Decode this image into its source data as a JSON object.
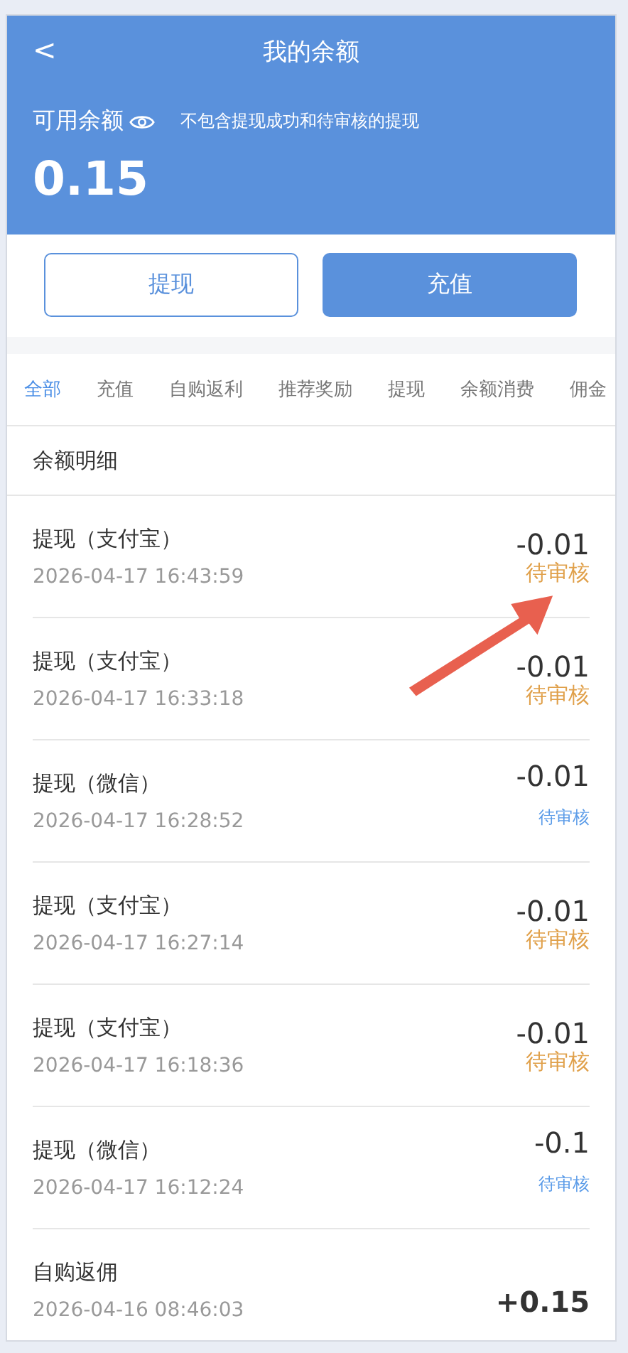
{
  "header": {
    "back": "<",
    "title": "我的余额"
  },
  "balance": {
    "label": "可用余额",
    "hint": "不包含提现成功和待审核的提现",
    "amount": "0.15"
  },
  "buttons": [
    {
      "label": "提现",
      "kind": "outline"
    },
    {
      "label": "充值",
      "kind": "filled"
    }
  ],
  "tabs": [
    {
      "label": "全部",
      "selected": true
    },
    {
      "label": "充值",
      "selected": false
    },
    {
      "label": "自购返利",
      "selected": false
    },
    {
      "label": "推荐奖励",
      "selected": false
    },
    {
      "label": "提现",
      "selected": false
    },
    {
      "label": "余额消费",
      "selected": false
    },
    {
      "label": "佣金",
      "selected": false
    }
  ],
  "section_title": "余额明细",
  "records": [
    {
      "title": "提现（支付宝）",
      "time": "2026-04-17 16:43:59",
      "amount": "-0.01",
      "status": "待审核",
      "kind": "alipay"
    },
    {
      "title": "提现（支付宝）",
      "time": "2026-04-17 16:33:18",
      "amount": "-0.01",
      "status": "待审核",
      "kind": "alipay"
    },
    {
      "title": "提现（微信）",
      "time": "2026-04-17 16:28:52",
      "amount": "-0.01",
      "status": "待审核",
      "kind": "wechat"
    },
    {
      "title": "提现（支付宝）",
      "time": "2026-04-17 16:27:14",
      "amount": "-0.01",
      "status": "待审核",
      "kind": "alipay"
    },
    {
      "title": "提现（支付宝）",
      "time": "2026-04-17 16:18:36",
      "amount": "-0.01",
      "status": "待审核",
      "kind": "alipay"
    },
    {
      "title": "提现（微信）",
      "time": "2026-04-17 16:12:24",
      "amount": "-0.1",
      "status": "待审核",
      "kind": "wechat"
    },
    {
      "title": "自购返佣",
      "time": "2026-04-16 08:46:03",
      "amount": "+0.15",
      "kind": "credit"
    }
  ]
}
